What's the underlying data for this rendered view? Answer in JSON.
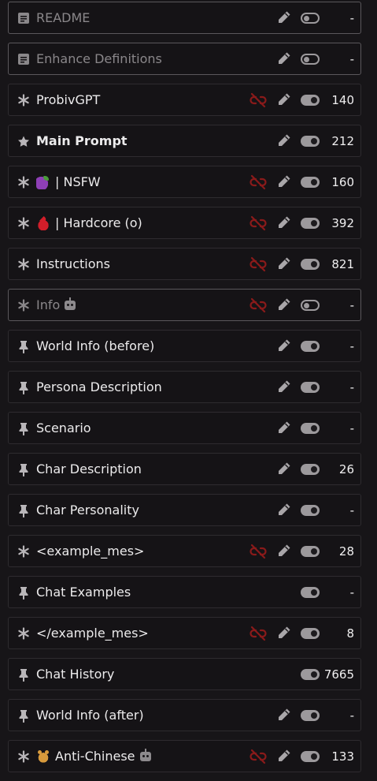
{
  "rows": [
    {
      "name": "README",
      "icon": "doc",
      "state": "disabled",
      "bold": false,
      "emoji": null,
      "robot": false,
      "unlink": false,
      "edit": true,
      "toggle": "off",
      "tokens": "-"
    },
    {
      "name": "Enhance Definitions",
      "icon": "doc",
      "state": "disabled",
      "bold": false,
      "emoji": null,
      "robot": false,
      "unlink": false,
      "edit": true,
      "toggle": "off",
      "tokens": "-"
    },
    {
      "name": "ProbivGPT",
      "icon": "asterisk",
      "state": "enabled",
      "bold": false,
      "emoji": null,
      "robot": false,
      "unlink": true,
      "edit": true,
      "toggle": "on",
      "tokens": "140"
    },
    {
      "name": "Main Prompt",
      "icon": "star",
      "state": "enabled",
      "bold": true,
      "emoji": null,
      "robot": false,
      "unlink": false,
      "edit": true,
      "toggle": "on",
      "tokens": "212"
    },
    {
      "name": "| NSFW",
      "icon": "asterisk",
      "state": "enabled",
      "bold": false,
      "emoji": "eggplant",
      "robot": false,
      "unlink": true,
      "edit": true,
      "toggle": "on",
      "tokens": "160"
    },
    {
      "name": "| Hardcore (o)",
      "icon": "asterisk",
      "state": "enabled",
      "bold": false,
      "emoji": "drop",
      "robot": false,
      "unlink": true,
      "edit": true,
      "toggle": "on",
      "tokens": "392"
    },
    {
      "name": "Instructions",
      "icon": "asterisk",
      "state": "enabled",
      "bold": false,
      "emoji": null,
      "robot": false,
      "unlink": true,
      "edit": true,
      "toggle": "on",
      "tokens": "821"
    },
    {
      "name": "Info",
      "icon": "asterisk",
      "state": "disabled",
      "bold": false,
      "emoji": null,
      "robot": true,
      "unlink": true,
      "edit": true,
      "toggle": "off",
      "tokens": "-"
    },
    {
      "name": "World Info (before)",
      "icon": "pin",
      "state": "enabled",
      "bold": false,
      "emoji": null,
      "robot": false,
      "unlink": false,
      "edit": true,
      "toggle": "on",
      "tokens": "-"
    },
    {
      "name": "Persona Description",
      "icon": "pin",
      "state": "enabled",
      "bold": false,
      "emoji": null,
      "robot": false,
      "unlink": false,
      "edit": true,
      "toggle": "on",
      "tokens": "-"
    },
    {
      "name": "Scenario",
      "icon": "pin",
      "state": "enabled",
      "bold": false,
      "emoji": null,
      "robot": false,
      "unlink": false,
      "edit": true,
      "toggle": "on",
      "tokens": "-"
    },
    {
      "name": "Char Description",
      "icon": "pin",
      "state": "enabled",
      "bold": false,
      "emoji": null,
      "robot": false,
      "unlink": false,
      "edit": true,
      "toggle": "on",
      "tokens": "26"
    },
    {
      "name": "Char Personality",
      "icon": "pin",
      "state": "enabled",
      "bold": false,
      "emoji": null,
      "robot": false,
      "unlink": false,
      "edit": true,
      "toggle": "on",
      "tokens": "-"
    },
    {
      "name": "<example_mes>",
      "icon": "asterisk",
      "state": "enabled",
      "bold": false,
      "emoji": null,
      "robot": false,
      "unlink": true,
      "edit": true,
      "toggle": "on",
      "tokens": "28"
    },
    {
      "name": "Chat Examples",
      "icon": "pin",
      "state": "enabled",
      "bold": false,
      "emoji": null,
      "robot": false,
      "unlink": false,
      "edit": false,
      "toggle": "on",
      "tokens": "-"
    },
    {
      "name": "</example_mes>",
      "icon": "asterisk",
      "state": "enabled",
      "bold": false,
      "emoji": null,
      "robot": false,
      "unlink": true,
      "edit": true,
      "toggle": "on",
      "tokens": "8"
    },
    {
      "name": "Chat History",
      "icon": "pin",
      "state": "enabled",
      "bold": false,
      "emoji": null,
      "robot": false,
      "unlink": false,
      "edit": false,
      "toggle": "on",
      "tokens": "7665"
    },
    {
      "name": "World Info (after)",
      "icon": "pin",
      "state": "enabled",
      "bold": false,
      "emoji": null,
      "robot": false,
      "unlink": false,
      "edit": true,
      "toggle": "on",
      "tokens": "-"
    },
    {
      "name": "Anti-Chinese",
      "icon": "asterisk",
      "state": "enabled",
      "bold": false,
      "emoji": "bear",
      "robot": true,
      "unlink": true,
      "edit": true,
      "toggle": "on",
      "tokens": "133"
    }
  ],
  "colors": {
    "unlink": "#8a1a1a",
    "edit": "#a9a6a9",
    "toggle": "#9c999c"
  }
}
